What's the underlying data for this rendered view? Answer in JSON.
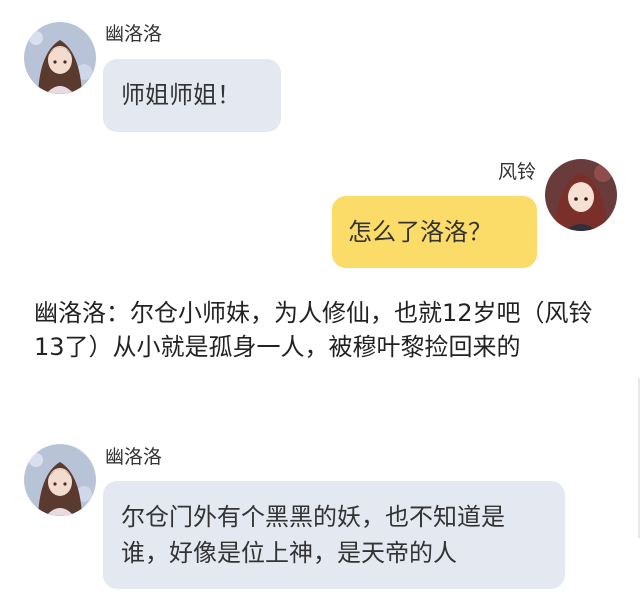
{
  "messages": [
    {
      "sender": "幽洛洛",
      "side": "left",
      "text": "师姐师姐！",
      "avatar": "girl-avatar-icon"
    },
    {
      "sender": "风铃",
      "side": "right",
      "text": "怎么了洛洛？",
      "avatar": "girl-avatar-icon"
    },
    {
      "sender": "幽洛洛",
      "side": "left",
      "text": "尔仓门外有个黑黑的妖，也不知道是谁，好像是位上神，是天帝的人",
      "avatar": "girl-avatar-icon"
    }
  ],
  "narration": "幽洛洛：尔仓小师妹，为人修仙，也就12岁吧（风铃13了）从小就是孤身一人，被穆叶黎捡回来的",
  "colors": {
    "left_bubble": "#e4e9f1",
    "right_bubble": "#fcdc68",
    "background": "#ffffff"
  }
}
